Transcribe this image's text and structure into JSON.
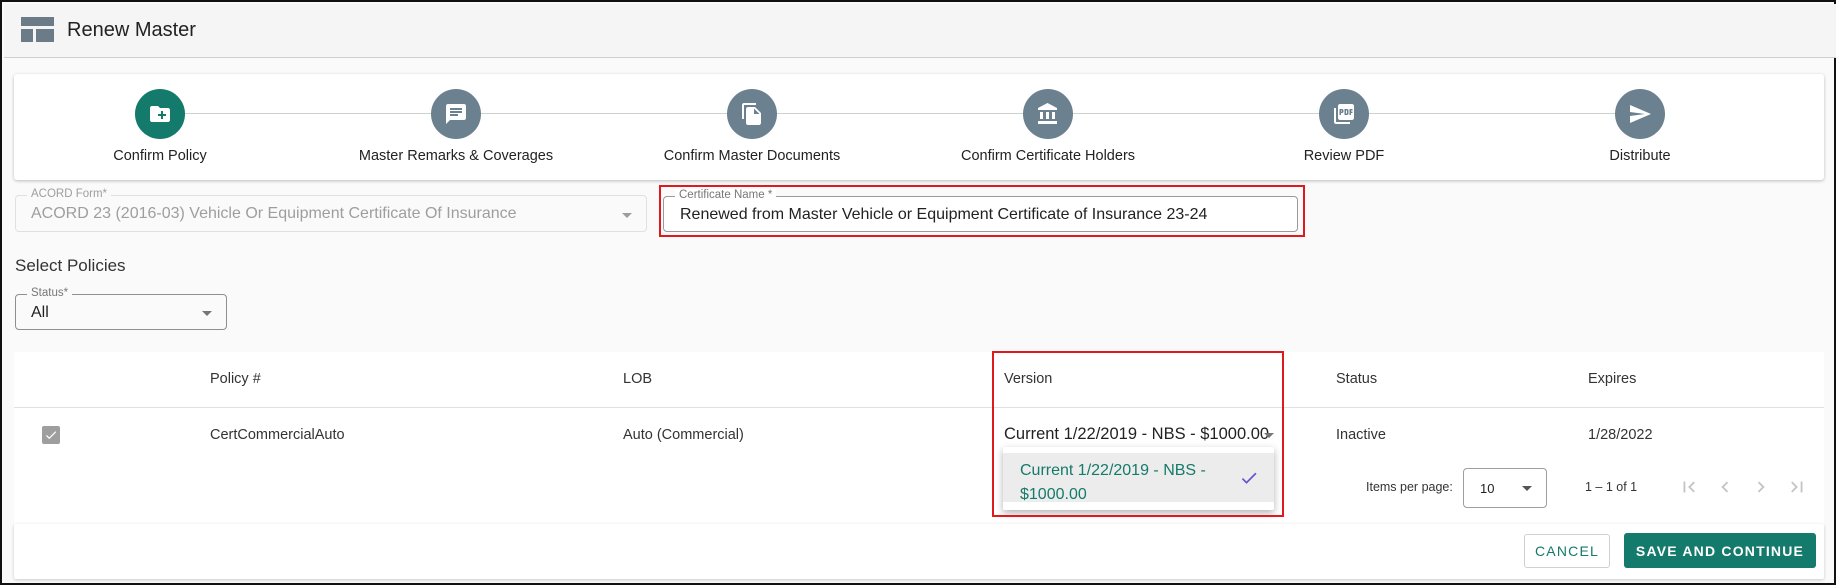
{
  "header": {
    "title": "Renew Master",
    "icon": "dashboard-layout-icon"
  },
  "stepper": {
    "steps": [
      {
        "label": "Confirm Policy",
        "icon": "folder-add-icon",
        "active": true
      },
      {
        "label": "Master Remarks & Coverages",
        "icon": "comment-icon",
        "active": false
      },
      {
        "label": "Confirm Master Documents",
        "icon": "documents-icon",
        "active": false
      },
      {
        "label": "Confirm Certificate Holders",
        "icon": "bank-icon",
        "active": false
      },
      {
        "label": "Review PDF",
        "icon": "pdf-icon",
        "active": false
      },
      {
        "label": "Distribute",
        "icon": "send-icon",
        "active": false
      }
    ]
  },
  "form": {
    "acord_label": "ACORD Form*",
    "acord_value": "ACORD 23 (2016-03) Vehicle Or Equipment Certificate Of Insurance",
    "cert_label": "Certificate Name *",
    "cert_value": "Renewed from Master Vehicle or Equipment Certificate of Insurance 23-24"
  },
  "policies": {
    "section_title": "Select Policies",
    "status_label": "Status*",
    "status_value": "All",
    "columns": [
      "Policy #",
      "LOB",
      "Version",
      "Status",
      "Expires"
    ],
    "rows": [
      {
        "checked": true,
        "policy": "CertCommercialAuto",
        "lob": "Auto (Commercial)",
        "version": "Current 1/22/2019 - NBS - $1000.00",
        "status": "Inactive",
        "expires": "1/28/2022"
      }
    ],
    "version_options": [
      "Current 1/22/2019 - NBS - $1000.00"
    ]
  },
  "pager": {
    "items_per_page_label": "Items per page:",
    "items_per_page": "10",
    "range": "1 – 1 of 1"
  },
  "footer": {
    "cancel": "CANCEL",
    "save": "SAVE AND CONTINUE"
  },
  "colors": {
    "accent": "#147a6b",
    "step_inactive": "#6b818f",
    "highlight": "#e0191c"
  }
}
